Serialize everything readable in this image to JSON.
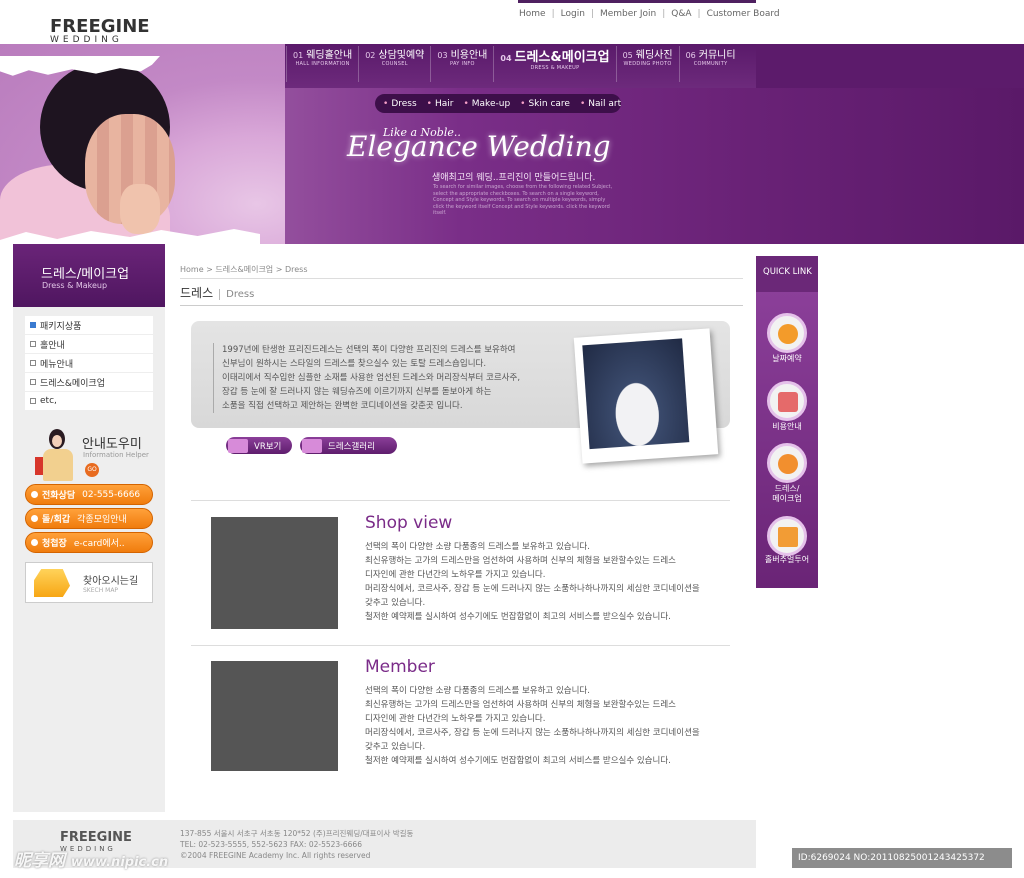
{
  "logo": {
    "line1": "FREEGINE",
    "line2": "WEDDING"
  },
  "top_links": [
    "Home",
    "Login",
    "Member Join",
    "Q&A",
    "Customer Board"
  ],
  "gnb": [
    {
      "num": "01",
      "label": "웨딩홀안내",
      "sub": "HALL INFORMATION"
    },
    {
      "num": "02",
      "label": "상담및예약",
      "sub": "COUNSEL"
    },
    {
      "num": "03",
      "label": "비용안내",
      "sub": "PAY INFO"
    },
    {
      "num": "04",
      "label": "드레스&메이크업",
      "sub": "DRESS & MAKEUP"
    },
    {
      "num": "05",
      "label": "웨딩사진",
      "sub": "WEDDING PHOTO"
    },
    {
      "num": "06",
      "label": "커뮤니티",
      "sub": "COMMUNITY"
    }
  ],
  "subnav": [
    "Dress",
    "Hair",
    "Make-up",
    "Skin care",
    "Nail art"
  ],
  "slogan": {
    "small": "Like a Noble..",
    "big": "Elegance Wedding",
    "sub": "생애최고의 웨딩..프리진이 만들어드립니다.",
    "fine": "To search for similar images, choose from the following related Subject, select the appropriate checkboxes. To search on a single keyword, Concept and Style keywords. To search on multiple keywords, simply click the keyword itself Concept and Style keywords. click the keyword itself."
  },
  "left": {
    "title": "드레스/메이크업",
    "subtitle": "Dress & Makeup",
    "menu": [
      "패키지상품",
      "홀안내",
      "메뉴안내",
      "드레스&메이크업",
      "etc,"
    ],
    "helper_title": "안내도우미",
    "helper_sub": "Information Helper",
    "helper_go": "GO",
    "buttons": [
      {
        "label": "전화상담",
        "value": "02-555-6666"
      },
      {
        "label": "돌/회갑",
        "value": "각종모임안내"
      },
      {
        "label": "청첩장",
        "value": "e-card에서.."
      }
    ],
    "map_title": "찾아오시는길",
    "map_sub": "SKECH MAP"
  },
  "breadcrumb": "Home > 드레스&메이크업 > Dress",
  "page_title": "드레스",
  "page_title_en": "Dress",
  "intro": [
    "1997년에 탄생한 프리진드레스는 선택의 폭이 다양한 프리진의 드레스를 보유하여",
    "신부님이 원하시는 스타일의 드레스를 찾으실수 있는 토탈 드레스숍입니다.",
    "이태리에서 직수입한 심플한 소재를 사용한 엄선된 드레스와 머리장식부터 코르사주,",
    "장갑 등 눈에 잘 드러나지 않는 웨딩슈즈에 이르기까지 신부를 돋보아게 하는",
    "소품을 직접 선택하고 제안하는 완벽한 코디네이션을 갖춘곳 입니다."
  ],
  "buttons": {
    "vr": "VR보기",
    "gallery": "드레스갤러리"
  },
  "sections": [
    {
      "title": "Shop view",
      "lines": [
        "선택의 폭이 다양한 소량 다품종의 드레스를 보유하고 있습니다.",
        "최신유행하는 고가의 드레스만을 엄선하여 사용하며 신부의 체형을 보완할수있는 드레스",
        "디자인에 관한 다년간의 노하우를 가지고 있습니다.",
        "머리장식에서, 코르사주, 장갑 등 눈에 드러나지 않는 소품하나하나까지의 세심한 코디네이션을",
        "갖추고 있습니다.",
        "철저한 예약제를 실시하여 성수기에도 번잡함없이 최고의 서비스를 받으실수 있습니다."
      ]
    },
    {
      "title": "Member",
      "lines": [
        "선택의 폭이 다양한 소량 다품종의 드레스를 보유하고 있습니다.",
        "최신유행하는 고가의 드레스만을 엄선하여 사용하며 신부의 체형을 보완할수있는 드레스",
        "디자인에 관한 다년간의 노하우를 가지고 있습니다.",
        "머리장식에서, 코르사주, 장갑 등 눈에 드러나지 않는 소품하나하나까지의 세심한 코디네이션을",
        "갖추고 있습니다.",
        "철저한 예약제를 실시하여 성수기에도 번잡함없이 최고의 서비스를 받으실수 있습니다."
      ]
    }
  ],
  "quick": {
    "title": "QUICK LINK",
    "items": [
      "날짜예약",
      "비용안내",
      "드레스/\n메이크업",
      "홀버추얼투어"
    ]
  },
  "footer": {
    "logo1": "FREEGINE",
    "logo2": "WEDDING",
    "line1": "137-855 서울시 서초구 서초동 120*52 (주)프리진웨딩/대표이사 박길동",
    "line2": "TEL: 02-523-5555, 552-5623    FAX: 02-5523-6666",
    "line3": "©2004 FREEGINE Academy Inc. All rights reserved"
  },
  "watermark": {
    "left": "昵享网",
    "left_url": "www.nipic.cn",
    "right": "ID:6269024 NO:20110825001243425372"
  },
  "colors": {
    "primary": "#6b2378",
    "accent_orange": "#f07c0d",
    "title_purple": "#7a2b88"
  }
}
